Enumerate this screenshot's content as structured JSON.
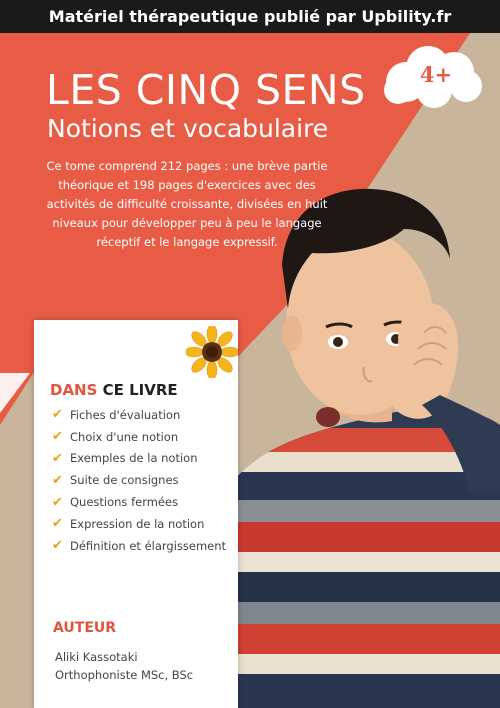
{
  "banner": {
    "text": "Matériel thérapeutique publié par Upbility.fr"
  },
  "cover": {
    "title": "LES CINQ SENS",
    "subtitle": "Notions et vocabulaire",
    "age": "4+",
    "description": "Ce tome comprend 212 pages : une brève partie théorique et 198 pages d'exercices avec des activités de difficulté croissante, divisées en huit niveaux pour développer peu à peu le langage réceptif et le langage expressif."
  },
  "book_section": {
    "heading_accent": "DANS",
    "heading_rest": " CE LIVRE",
    "items": [
      "Fiches d'évaluation",
      "Choix d'une notion",
      "Exemples de la notion",
      "Suite de consignes",
      "Questions fermées",
      "Expression de la notion",
      "Définition et élargissement"
    ]
  },
  "author": {
    "heading": "AUTEUR",
    "name": "Aliki Kassotaki",
    "title": "Orthophoniste MSc, BSc"
  },
  "colors": {
    "coral": "#e85c45",
    "beige": "#c9b79f",
    "check": "#e8a21f"
  },
  "icons": {
    "check": "checkmark-icon",
    "flower": "sunflower-icon",
    "cloud": "cloud-badge-icon"
  }
}
